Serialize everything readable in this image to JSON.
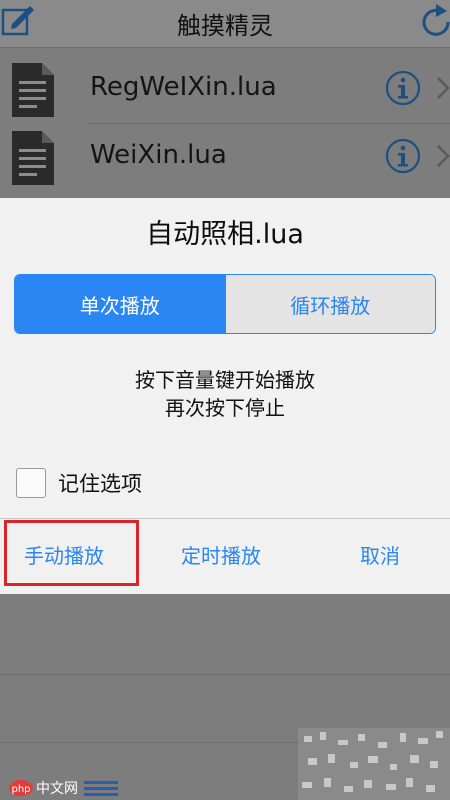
{
  "app": {
    "title": "触摸精灵",
    "files": [
      {
        "name": "RegWeIXin.lua"
      },
      {
        "name": "WeiXin.lua"
      }
    ]
  },
  "dialog": {
    "title": "自动照相.lua",
    "segments": [
      {
        "label": "单次播放",
        "selected": true
      },
      {
        "label": "循环播放",
        "selected": false
      }
    ],
    "message_line1": "按下音量键开始播放",
    "message_line2": "再次按下停止",
    "remember_label": "记住选项",
    "remember_checked": false,
    "actions": {
      "manual": "手动播放",
      "timed": "定时播放",
      "cancel": "取消"
    }
  },
  "watermark": {
    "text": "中文网"
  },
  "colors": {
    "accent": "#2a86f2",
    "highlight": "#d9252b",
    "dim_background": "#7d7d7d"
  }
}
